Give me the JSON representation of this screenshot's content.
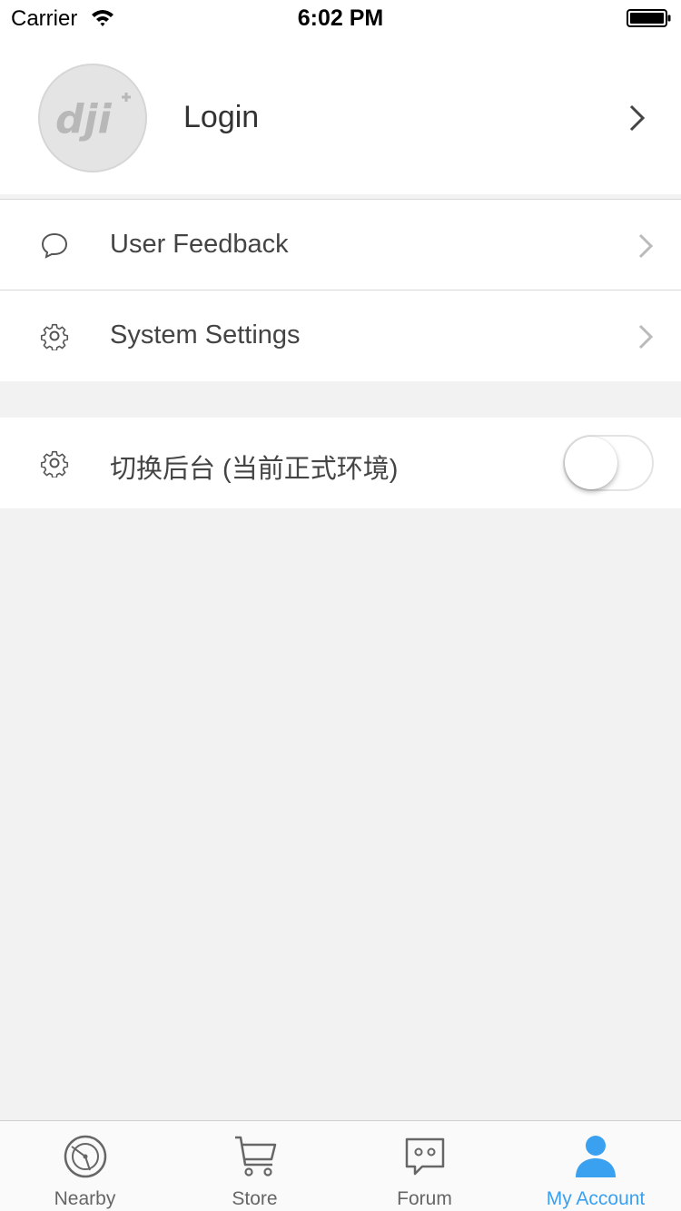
{
  "status_bar": {
    "carrier": "Carrier",
    "time": "6:02 PM"
  },
  "profile": {
    "avatar_logo_text": "dji",
    "login_label": "Login"
  },
  "menu": {
    "feedback_label": "User Feedback",
    "settings_label": "System Settings",
    "switch_label": "切换后台 (当前正式环境)",
    "switch_on": false
  },
  "tabs": [
    {
      "label": "Nearby",
      "icon": "radar-icon",
      "active": false
    },
    {
      "label": "Store",
      "icon": "cart-icon",
      "active": false
    },
    {
      "label": "Forum",
      "icon": "chat-bubble-icon",
      "active": false
    },
    {
      "label": "My Account",
      "icon": "person-icon",
      "active": true
    }
  ],
  "colors": {
    "accent": "#3aa0f0",
    "background": "#f2f2f2",
    "text": "#444444"
  }
}
